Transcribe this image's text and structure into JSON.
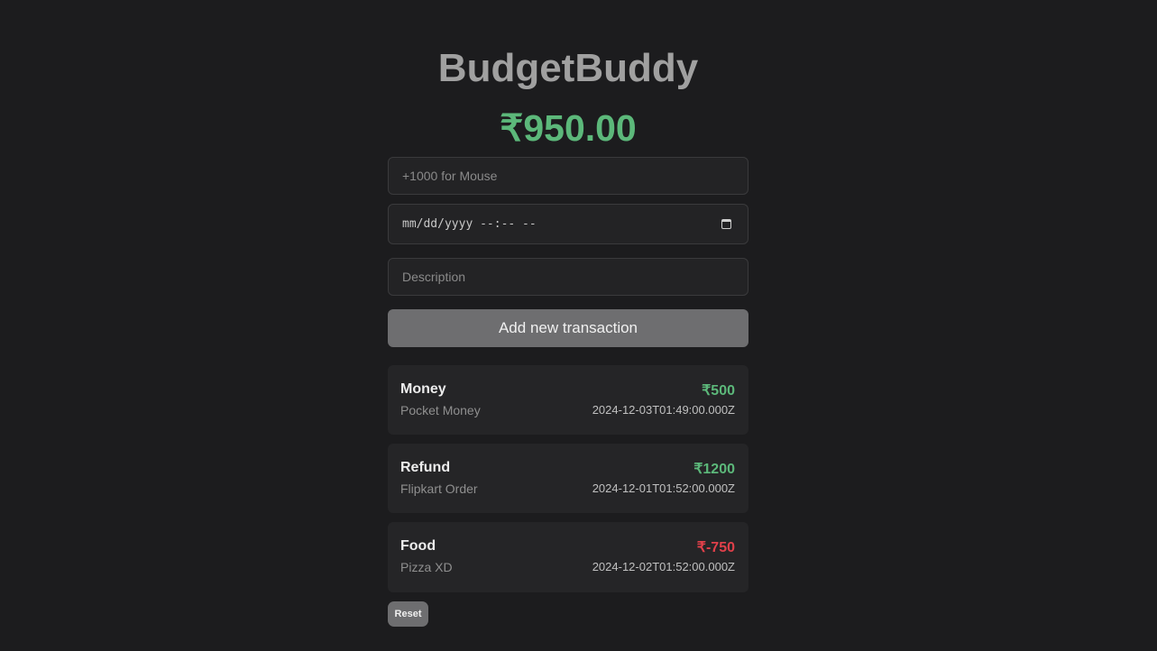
{
  "app": {
    "title": "BudgetBuddy",
    "balance": "₹950.00"
  },
  "form": {
    "amount_placeholder": "+1000 for Mouse",
    "date_placeholder": "mm/dd/yyyy --:-- --",
    "description_placeholder": "Description",
    "submit_label": "Add new transaction"
  },
  "transactions": [
    {
      "name": "Money",
      "description": "Pocket Money",
      "amount": "₹500",
      "datetime": "2024-12-03T01:49:00.000Z",
      "sign": "positive"
    },
    {
      "name": "Refund",
      "description": "Flipkart Order",
      "amount": "₹1200",
      "datetime": "2024-12-01T01:52:00.000Z",
      "sign": "positive"
    },
    {
      "name": "Food",
      "description": "Pizza XD",
      "amount": "₹-750",
      "datetime": "2024-12-02T01:52:00.000Z",
      "sign": "negative"
    }
  ],
  "reset_label": "Reset",
  "colors": {
    "background": "#1c1c1e",
    "positive": "#5cb87a",
    "negative": "#e0404a",
    "button": "#6e6e70"
  },
  "icons": {
    "date_picker": "calendar-icon"
  }
}
